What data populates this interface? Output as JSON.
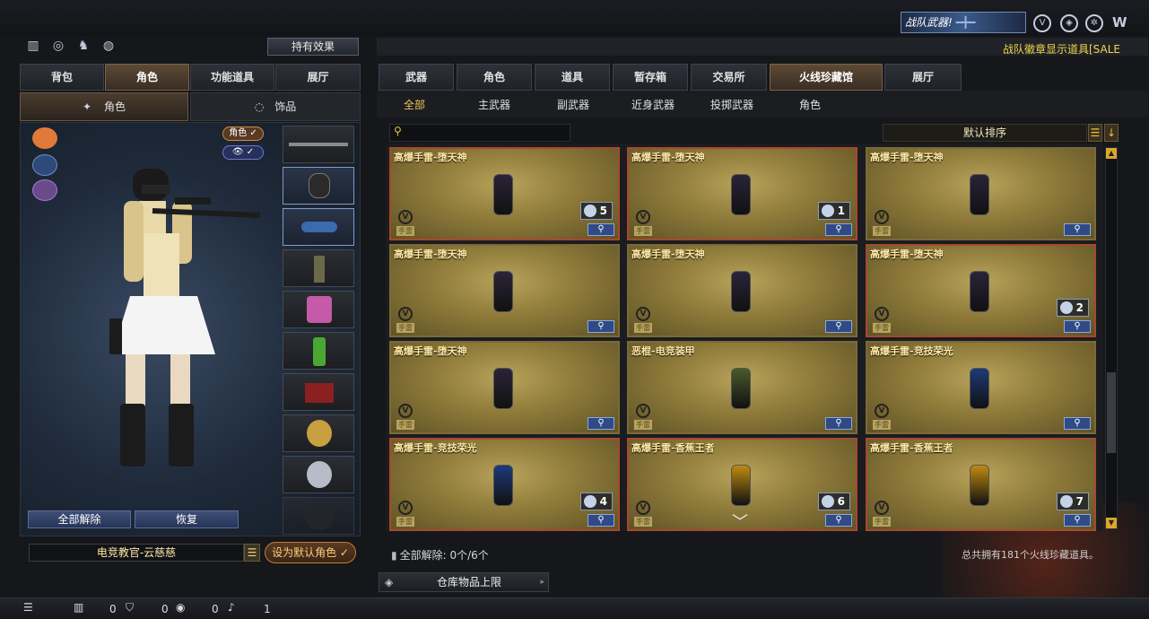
{
  "header": {
    "banner_text": "战队武器!",
    "sale_text": "战队徽章显示道具[SALE",
    "holding_effect": "持有效果"
  },
  "left_tabs": [
    {
      "label": "背包",
      "active": false
    },
    {
      "label": "角色",
      "active": true
    },
    {
      "label": "功能道具",
      "active": false
    },
    {
      "label": "展厅",
      "active": false
    }
  ],
  "left_subtabs": [
    {
      "label": "角色",
      "active": true
    },
    {
      "label": "饰品",
      "active": false
    }
  ],
  "char_chips": {
    "role": "角色 ✓",
    "view": "👁 ✓"
  },
  "left_buttons": {
    "unequip_all": "全部解除",
    "restore": "恢复"
  },
  "character_name": "电竞教官-云慈慈",
  "set_default_label": "设为默认角色 ✓",
  "right_tabs": [
    {
      "label": "武器",
      "active": false
    },
    {
      "label": "角色",
      "active": false
    },
    {
      "label": "道具",
      "active": false
    },
    {
      "label": "暂存箱",
      "active": false
    },
    {
      "label": "交易所",
      "active": false
    },
    {
      "label": "火线珍藏馆",
      "active": true
    },
    {
      "label": "展厅",
      "active": false
    }
  ],
  "categories": [
    {
      "label": "全部",
      "active": true
    },
    {
      "label": "主武器",
      "active": false
    },
    {
      "label": "副武器",
      "active": false
    },
    {
      "label": "近身武器",
      "active": false
    },
    {
      "label": "投掷武器",
      "active": false
    },
    {
      "label": "角色",
      "active": false
    }
  ],
  "sort_label": "默认排序",
  "cards": [
    {
      "title": "高爆手雷-堕天神",
      "count": "5",
      "item_color": "#2a2438",
      "highlight": true
    },
    {
      "title": "高爆手雷-堕天神",
      "count": "1",
      "item_color": "#2a2438",
      "highlight": true
    },
    {
      "title": "高爆手雷-堕天神",
      "count": "",
      "item_color": "#2a2438",
      "highlight": false
    },
    {
      "title": "高爆手雷-堕天神",
      "count": "",
      "item_color": "#2a2438",
      "highlight": false
    },
    {
      "title": "高爆手雷-堕天神",
      "count": "",
      "item_color": "#2a2438",
      "highlight": false
    },
    {
      "title": "高爆手雷-堕天神",
      "count": "2",
      "item_color": "#2a2438",
      "highlight": true
    },
    {
      "title": "高爆手雷-堕天神",
      "count": "",
      "item_color": "#2a2438",
      "highlight": false
    },
    {
      "title": "恶棍-电竞装甲",
      "count": "",
      "item_color": "#4a5a2a",
      "highlight": false
    },
    {
      "title": "高爆手雷-竞技荣光",
      "count": "",
      "item_color": "#1d3a78",
      "highlight": false
    },
    {
      "title": "高爆手雷-竞技荣光",
      "count": "4",
      "item_color": "#1d3a78",
      "highlight": true
    },
    {
      "title": "高爆手雷-香蕉王者",
      "count": "6",
      "item_color": "#c08a10",
      "highlight": true
    },
    {
      "title": "高爆手雷-香蕉王者",
      "count": "7",
      "item_color": "#c08a10",
      "highlight": true
    }
  ],
  "card_tag": "手雷",
  "footer": {
    "unequip_all": "全部解除: 0个/6个",
    "total": "总共拥有181个火线珍藏道具。",
    "warehouse": "仓库物品上限"
  },
  "statusbar": {
    "count_a": "0",
    "count_b": "0",
    "count_c": "0",
    "count_d": "1"
  },
  "colors": {
    "accent_gold": "#f0d64a",
    "card_border_red": "#a8482f",
    "zoom_blue": "#2f4a86"
  }
}
